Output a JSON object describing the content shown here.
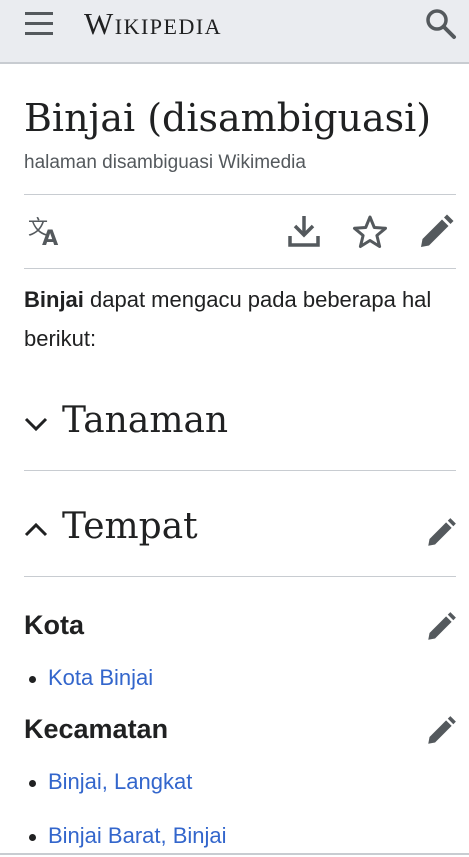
{
  "header": {
    "logo_text": "Wikipedia",
    "menu_icon": "hamburger-menu-icon",
    "search_icon": "search-icon"
  },
  "page": {
    "title": "Binjai (disambiguasi)",
    "subtitle": "halaman disambiguasi Wikimedia"
  },
  "page_actions": [
    {
      "name": "language",
      "icon": "translate-icon"
    },
    {
      "name": "download",
      "icon": "download-icon"
    },
    {
      "name": "watch",
      "icon": "star-icon"
    },
    {
      "name": "edit",
      "icon": "pencil-icon"
    }
  ],
  "intro": {
    "bold": "Binjai",
    "rest": " dapat mengacu pada beberapa hal berikut:"
  },
  "sections": [
    {
      "title": "Tanaman",
      "expanded": false,
      "editable": false
    },
    {
      "title": "Tempat",
      "expanded": true,
      "editable": true
    }
  ],
  "subsections": [
    {
      "title": "Kota",
      "items": [
        "Kota Binjai"
      ]
    },
    {
      "title": "Kecamatan",
      "items": [
        "Binjai, Langkat",
        "Binjai Barat, Binjai"
      ]
    }
  ],
  "colors": {
    "link": "#3366cc",
    "text": "#202122",
    "muted": "#54595d",
    "header_bg": "#eaecf0",
    "divider": "#c8ccd1"
  }
}
